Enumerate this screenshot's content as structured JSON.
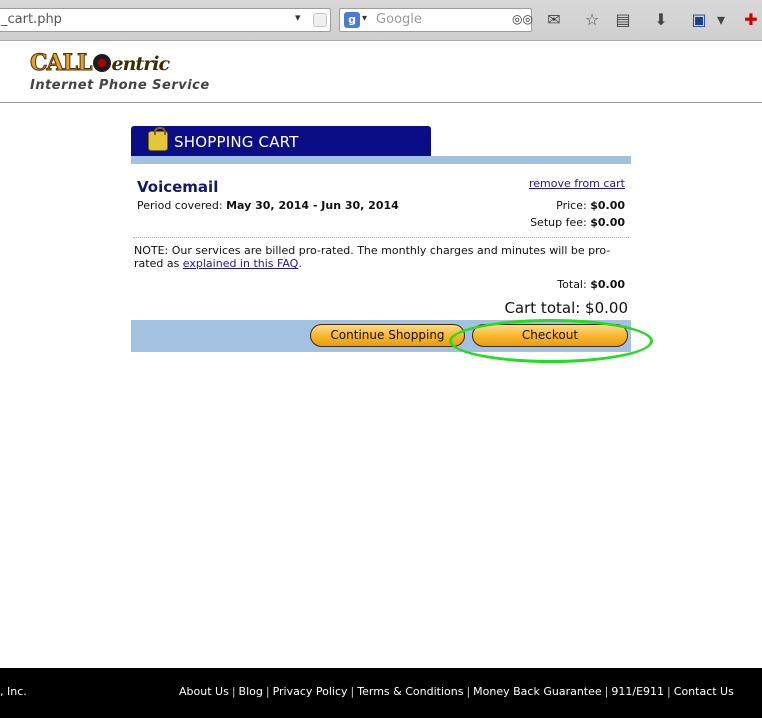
{
  "browser": {
    "url": "_cart.php",
    "search_placeholder": "Google"
  },
  "site": {
    "logo_call": "CALL",
    "logo_entric": "entric",
    "tagline": "Internet Phone Service"
  },
  "cart": {
    "title": "SHOPPING CART",
    "item": {
      "name": "Voicemail",
      "period_label": "Period covered:",
      "period_value": "May 30, 2014 - Jun 30, 2014",
      "remove_label": "remove from cart",
      "price_label": "Price:",
      "price_value": "$0.00",
      "setup_label": "Setup fee:",
      "setup_value": "$0.00"
    },
    "note_text": "NOTE: Our services are billed pro-rated. The monthly charges and minutes will be pro-rated as",
    "note_link": "explained in this FAQ",
    "note_end": ".",
    "total_label": "Total:",
    "total_value": "$0.00",
    "cart_total": "Cart total: $0.00",
    "continue_label": "Continue Shopping",
    "checkout_label": "Checkout"
  },
  "footer": {
    "copyright": ", Inc.",
    "links": [
      "About Us",
      "Blog",
      "Privacy Policy",
      "Terms & Conditions",
      "Money Back Guarantee",
      "911/E911",
      "Contact Us"
    ]
  },
  "colors": {
    "cart_header": "#0b0d86",
    "cart_bar": "#a3c2e3",
    "button": "#f7b52c",
    "highlight": "#22dd22",
    "footer": "#000000"
  }
}
